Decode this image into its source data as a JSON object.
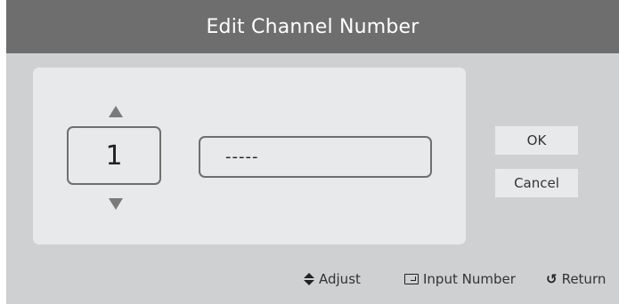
{
  "dialog": {
    "title": "Edit Channel Number"
  },
  "editor": {
    "channel_value": "1",
    "number_field_value": "-----"
  },
  "buttons": {
    "ok_label": "OK",
    "cancel_label": "Cancel"
  },
  "footer": {
    "adjust_label": "Adjust",
    "input_number_label": "Input Number",
    "return_label": "Return",
    "return_icon_glyph": "↺"
  },
  "colors": {
    "title_bar": "#6e6e6e",
    "background": "#cfd0d1",
    "panel": "#e8e9ea"
  }
}
